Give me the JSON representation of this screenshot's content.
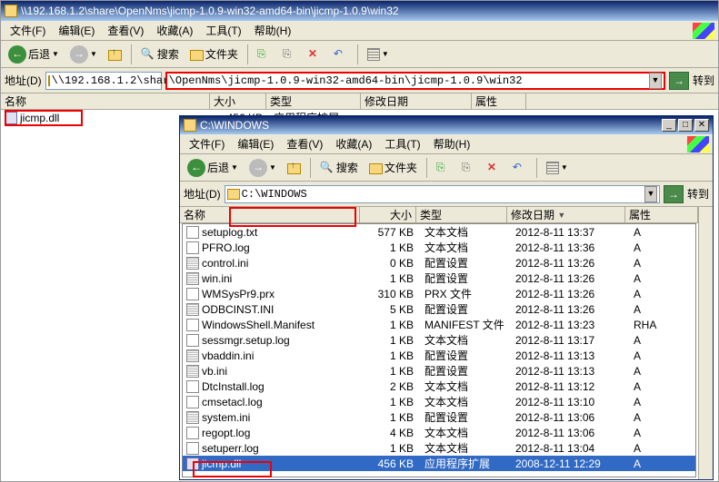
{
  "outer": {
    "title": "\\\\192.168.1.2\\share\\OpenNms\\jicmp-1.0.9-win32-amd64-bin\\jicmp-1.0.9\\win32",
    "menus": [
      "文件(F)",
      "编辑(E)",
      "查看(V)",
      "收藏(A)",
      "工具(T)",
      "帮助(H)"
    ],
    "back": "后退",
    "search": "搜索",
    "folders": "文件夹",
    "addr_label": "地址(D)",
    "addr_prefix": "\\\\192.168.1.2\\shar",
    "addr_box": "\\OpenNms\\jicmp-1.0.9-win32-amd64-bin\\jicmp-1.0.9\\win32",
    "go": "转到",
    "cols": {
      "name": "名称",
      "size": "大小",
      "type": "类型",
      "date": "修改日期",
      "attr": "属性"
    },
    "file": {
      "name": "jicmp.dll",
      "size": "456 KB",
      "type": "应用程序扩展"
    }
  },
  "inner": {
    "title": "C:\\WINDOWS",
    "menus": [
      "文件(F)",
      "编辑(E)",
      "查看(V)",
      "收藏(A)",
      "工具(T)",
      "帮助(H)"
    ],
    "back": "后退",
    "search": "搜索",
    "folders": "文件夹",
    "addr_label": "地址(D)",
    "addr_value": "C:\\WINDOWS",
    "go": "转到",
    "cols": {
      "name": "名称",
      "size": "大小",
      "type": "类型",
      "date": "修改日期",
      "sort": "▼",
      "attr": "属性"
    },
    "rows": [
      {
        "n": "setuplog.txt",
        "s": "577 KB",
        "t": "文本文档",
        "d": "2012-8-11 13:37",
        "a": "A",
        "ic": "txt"
      },
      {
        "n": "PFRO.log",
        "s": "1 KB",
        "t": "文本文档",
        "d": "2012-8-11 13:36",
        "a": "A",
        "ic": "txt"
      },
      {
        "n": "control.ini",
        "s": "0 KB",
        "t": "配置设置",
        "d": "2012-8-11 13:26",
        "a": "A",
        "ic": "ini"
      },
      {
        "n": "win.ini",
        "s": "1 KB",
        "t": "配置设置",
        "d": "2012-8-11 13:26",
        "a": "A",
        "ic": "ini"
      },
      {
        "n": "WMSysPr9.prx",
        "s": "310 KB",
        "t": "PRX 文件",
        "d": "2012-8-11 13:26",
        "a": "A",
        "ic": "txt"
      },
      {
        "n": "ODBCINST.INI",
        "s": "5 KB",
        "t": "配置设置",
        "d": "2012-8-11 13:26",
        "a": "A",
        "ic": "ini"
      },
      {
        "n": "WindowsShell.Manifest",
        "s": "1 KB",
        "t": "MANIFEST 文件",
        "d": "2012-8-11 13:23",
        "a": "RHA",
        "ic": "txt"
      },
      {
        "n": "sessmgr.setup.log",
        "s": "1 KB",
        "t": "文本文档",
        "d": "2012-8-11 13:17",
        "a": "A",
        "ic": "txt"
      },
      {
        "n": "vbaddin.ini",
        "s": "1 KB",
        "t": "配置设置",
        "d": "2012-8-11 13:13",
        "a": "A",
        "ic": "ini"
      },
      {
        "n": "vb.ini",
        "s": "1 KB",
        "t": "配置设置",
        "d": "2012-8-11 13:13",
        "a": "A",
        "ic": "ini"
      },
      {
        "n": "DtcInstall.log",
        "s": "2 KB",
        "t": "文本文档",
        "d": "2012-8-11 13:12",
        "a": "A",
        "ic": "txt"
      },
      {
        "n": "cmsetacl.log",
        "s": "1 KB",
        "t": "文本文档",
        "d": "2012-8-11 13:10",
        "a": "A",
        "ic": "txt"
      },
      {
        "n": "system.ini",
        "s": "1 KB",
        "t": "配置设置",
        "d": "2012-8-11 13:06",
        "a": "A",
        "ic": "ini"
      },
      {
        "n": "regopt.log",
        "s": "4 KB",
        "t": "文本文档",
        "d": "2012-8-11 13:06",
        "a": "A",
        "ic": "txt"
      },
      {
        "n": "setuperr.log",
        "s": "1 KB",
        "t": "文本文档",
        "d": "2012-8-11 13:04",
        "a": "A",
        "ic": "txt"
      },
      {
        "n": "jicmp.dll",
        "s": "456 KB",
        "t": "应用程序扩展",
        "d": "2008-12-11 12:29",
        "a": "A",
        "ic": "dll",
        "sel": true
      }
    ]
  }
}
